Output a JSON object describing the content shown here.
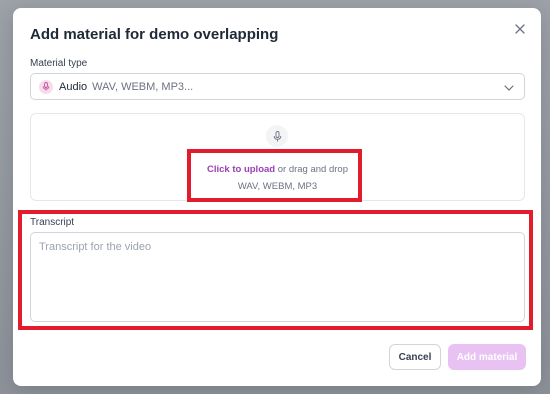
{
  "modal": {
    "title": "Add material for demo overlapping",
    "close_icon": "close-icon"
  },
  "material_type": {
    "label": "Material type",
    "selected_icon": "microphone-icon",
    "selected_type": "Audio",
    "selected_formats": "WAV, WEBM, MP3..."
  },
  "upload": {
    "icon": "microphone-icon",
    "link_text": "Click to upload",
    "rest_text": " or drag and drop",
    "formats": "WAV, WEBM, MP3"
  },
  "transcript": {
    "label": "Transcript",
    "placeholder": "Transcript for the video",
    "value": ""
  },
  "footer": {
    "cancel_label": "Cancel",
    "add_label": "Add material"
  },
  "colors": {
    "accent": "#9b3fb5",
    "add_button_disabled": "#e7c2f2",
    "highlight": "#e11d2b"
  }
}
